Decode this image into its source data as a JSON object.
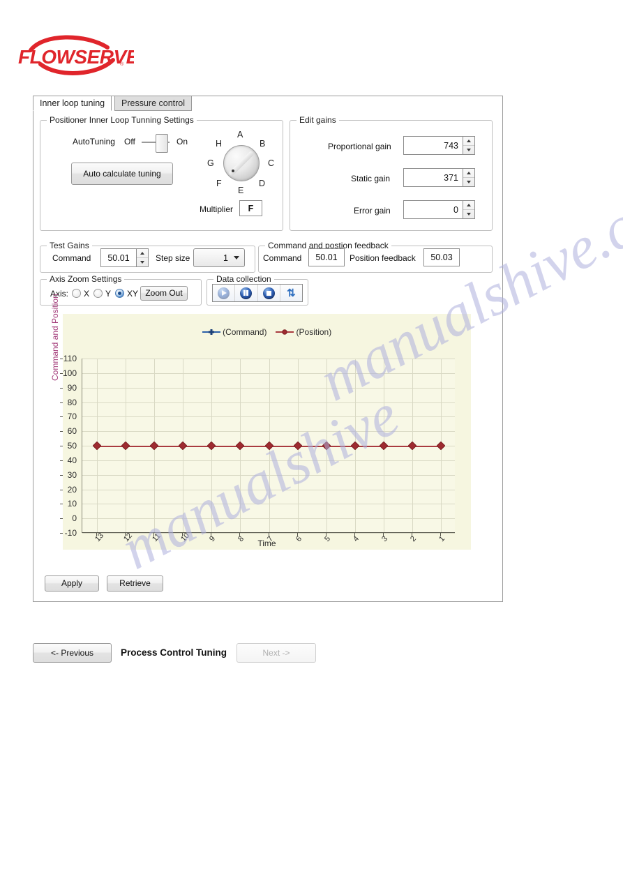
{
  "brand": {
    "name": "FLOWSERVE",
    "color": "#e0252b"
  },
  "tabs": [
    {
      "label": "Inner loop tuning",
      "active": true
    },
    {
      "label": "Pressure control",
      "active": false
    }
  ],
  "positioner": {
    "group_title": "Positioner Inner Loop Tunning Settings",
    "autotuning_label": "AutoTuning",
    "off_label": "Off",
    "on_label": "On",
    "toggle_state": "On",
    "auto_calculate_label": "Auto calculate tuning",
    "dial_letters": [
      "A",
      "B",
      "C",
      "D",
      "E",
      "F",
      "G",
      "H"
    ],
    "multiplier_label": "Multiplier",
    "multiplier_value": "F"
  },
  "edit_gains": {
    "group_title": "Edit gains",
    "rows": [
      {
        "label": "Proportional gain",
        "value": "743"
      },
      {
        "label": "Static gain",
        "value": "371"
      },
      {
        "label": "Error gain",
        "value": "0"
      }
    ]
  },
  "test_gains": {
    "group_title": "Test Gains",
    "command_label": "Command",
    "command_value": "50.01",
    "step_size_label": "Step size",
    "step_size_value": "1"
  },
  "feedback": {
    "group_title": "Command and postion feedback",
    "command_label": "Command",
    "command_value": "50.01",
    "position_label": "Position feedback",
    "position_value": "50.03"
  },
  "axis_zoom": {
    "group_title": "Axis Zoom Settings",
    "axis_label": "Axis:",
    "options": [
      {
        "label": "X",
        "selected": false
      },
      {
        "label": "Y",
        "selected": false
      },
      {
        "label": "XY",
        "selected": true
      }
    ],
    "zoom_out_label": "Zoom Out"
  },
  "data_collection": {
    "group_title": "Data collection",
    "buttons": [
      {
        "icon": "play-icon",
        "enabled": false
      },
      {
        "icon": "pause-icon",
        "enabled": true
      },
      {
        "icon": "stop-icon",
        "enabled": true
      },
      {
        "icon": "refresh-icon",
        "enabled": true
      }
    ]
  },
  "panel_actions": {
    "apply_label": "Apply",
    "retrieve_label": "Retrieve"
  },
  "footer": {
    "previous_label": "<- Previous",
    "title": "Process Control Tuning",
    "next_label": "Next  ->",
    "next_enabled": false
  },
  "watermark": {
    "line1": "manualshive.com",
    "line2": "manualshive"
  },
  "chart_data": {
    "type": "line",
    "title": "",
    "xlabel": "Time",
    "ylabel": "Command and Position",
    "x": [
      13,
      12,
      11,
      10,
      9,
      8,
      7,
      6,
      5,
      4,
      3,
      2,
      1
    ],
    "xtick_labels": [
      "13",
      "12",
      "11",
      "10",
      "9",
      "8",
      "7",
      "6",
      "5",
      "4",
      "3",
      "2",
      "1"
    ],
    "ytick_labels": [
      "110",
      "100",
      "90",
      "80",
      "70",
      "60",
      "50",
      "40",
      "30",
      "20",
      "10",
      "0",
      "-10"
    ],
    "ylim": [
      -10,
      110
    ],
    "ystep": 10,
    "grid": true,
    "legend_position": "top-center",
    "series": [
      {
        "name": "(Command)",
        "color": "#2b5fa8",
        "marker": "cross",
        "values": [
          50,
          50,
          50,
          50,
          50,
          50,
          50,
          50,
          50,
          50,
          50,
          50,
          50
        ]
      },
      {
        "name": "(Position)",
        "color": "#a93b40",
        "marker": "diamond",
        "values": [
          50,
          50,
          50,
          50,
          50,
          50,
          50,
          50,
          50,
          50,
          50,
          50,
          50
        ]
      }
    ]
  }
}
